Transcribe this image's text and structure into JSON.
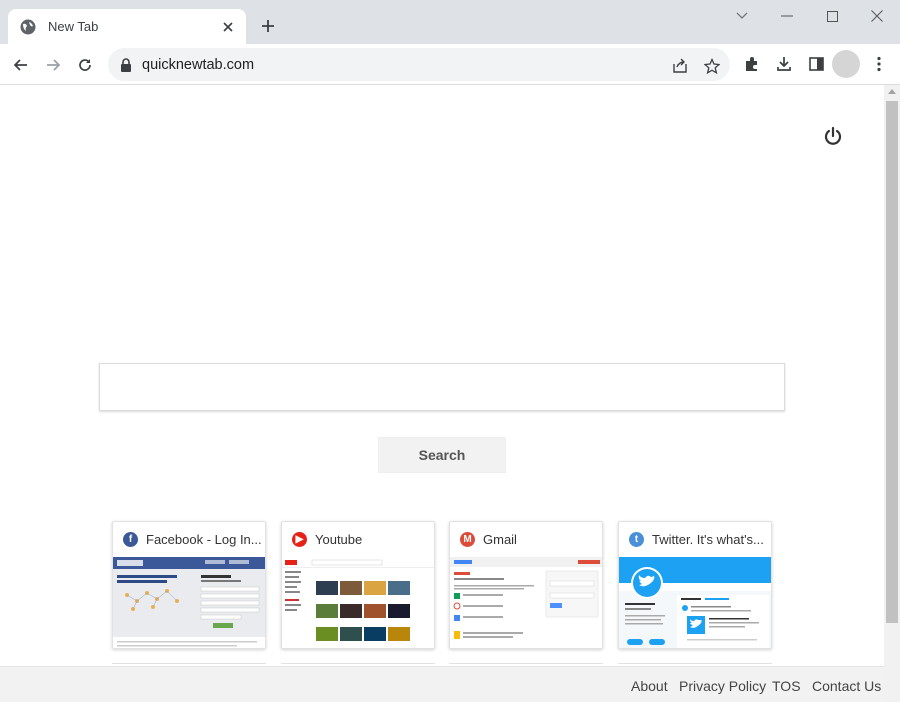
{
  "browser": {
    "tab": {
      "title": "New Tab"
    },
    "address": {
      "url": "quicknewtab.com"
    }
  },
  "search": {
    "button_label": "Search"
  },
  "tiles": [
    {
      "title": "Facebook - Log In...",
      "icon": "facebook-icon",
      "color": "#3b5998"
    },
    {
      "title": "Youtube",
      "icon": "youtube-icon",
      "color": "#e62117"
    },
    {
      "title": "Gmail",
      "icon": "gmail-icon",
      "color": "#dd4b39"
    },
    {
      "title": "Twitter. It's what's...",
      "icon": "twitter-icon",
      "color": "#4a90d9"
    }
  ],
  "footer": {
    "links": [
      "About",
      "Privacy Policy",
      "TOS",
      "Contact Us"
    ]
  },
  "colors": {
    "titlebar": "#dee1e6",
    "omnibox": "#f1f3f4",
    "footer": "#f2f2f2"
  }
}
